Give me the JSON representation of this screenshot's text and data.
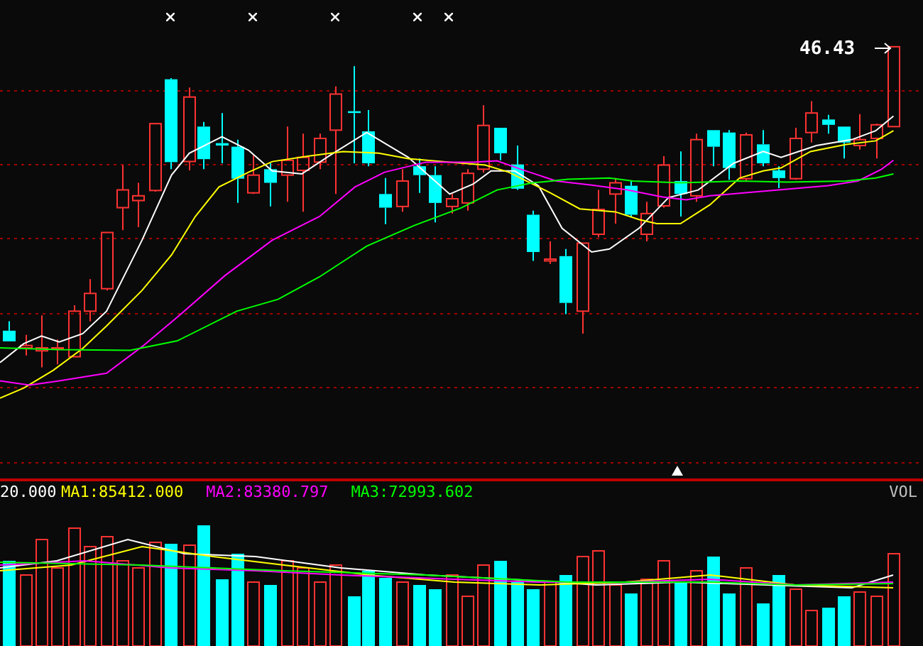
{
  "price_panel": {
    "last_price": "46.43"
  },
  "volume_panel": {
    "reading": "20.000",
    "ma_labels": [
      {
        "text": "MA1:85412.000",
        "color": "#ffff00"
      },
      {
        "text": "MA2:83380.797",
        "color": "#ff00ff"
      },
      {
        "text": "MA3:72993.602",
        "color": "#00ff00"
      }
    ],
    "label": "VOL"
  }
}
